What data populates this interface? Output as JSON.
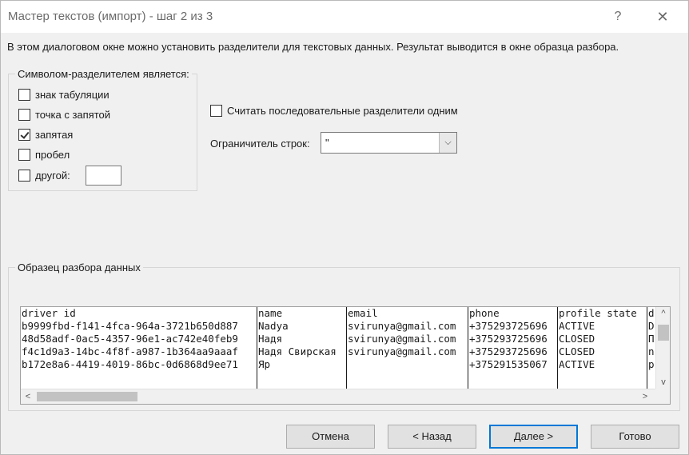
{
  "window": {
    "title": "Мастер текстов (импорт) - шаг 2 из 3",
    "help_glyph": "?",
    "close_glyph": "✕"
  },
  "intro_text": "В этом диалоговом окне можно установить разделители для текстовых данных. Результат выводится в окне образца разбора.",
  "delimiters": {
    "legend": "Символом-разделителем является:",
    "options": [
      {
        "label": "знак табуляции",
        "checked": false
      },
      {
        "label": "точка с запятой",
        "checked": false
      },
      {
        "label": "запятая",
        "checked": true
      },
      {
        "label": "пробел",
        "checked": false
      },
      {
        "label": "другой:",
        "checked": false
      }
    ],
    "other_value": ""
  },
  "consecutive": {
    "label": "Считать последовательные разделители одним",
    "checked": false
  },
  "text_qualifier": {
    "label": "Ограничитель строк:",
    "value": "\""
  },
  "preview": {
    "legend": "Образец разбора данных",
    "columns": [
      {
        "cells": [
          "driver id",
          "b9999fbd-f141-4fca-964a-3721b650d887",
          "48d58adf-0ac5-4357-96e1-ac742e40feb9",
          "f4c1d9a3-14bc-4f8f-a987-1b364aa9aaaf",
          "b172e8a6-4419-4019-86bc-0d6868d9ee71"
        ]
      },
      {
        "cells": [
          "name",
          "Nadya",
          "Надя",
          "Надя Свирская",
          "Яр"
        ]
      },
      {
        "cells": [
          "email",
          "svirunya@gmail.com",
          "svirunya@gmail.com",
          "svirunya@gmail.com",
          ""
        ]
      },
      {
        "cells": [
          "phone",
          "+375293725696",
          "+375293725696",
          "+375293725696",
          "+375291535067"
        ]
      },
      {
        "cells": [
          "profile state",
          "ACTIVE",
          "CLOSED",
          "CLOSED",
          "ACTIVE"
        ]
      },
      {
        "cells": [
          "d",
          "D",
          "П",
          "n",
          "p"
        ]
      }
    ],
    "scroll_left": "<",
    "scroll_right": ">",
    "scroll_up": "^",
    "scroll_down": "v"
  },
  "buttons": {
    "cancel": "Отмена",
    "back": "< Назад",
    "next": "Далее >",
    "finish": "Готово"
  }
}
